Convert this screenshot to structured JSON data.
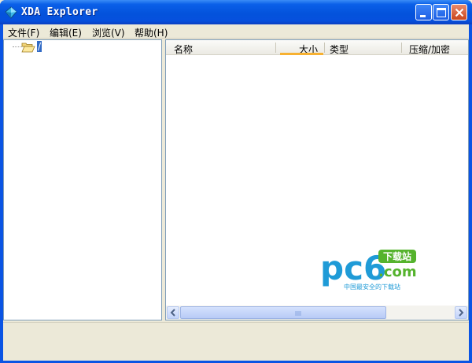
{
  "window": {
    "title": "XDA Explorer",
    "app_icon": "diamond-app-icon",
    "controls": [
      "minimize-icon",
      "maximize-icon",
      "close-icon"
    ]
  },
  "menu": {
    "items": [
      {
        "label": "文件(F)"
      },
      {
        "label": "编辑(E)"
      },
      {
        "label": "浏览(V)"
      },
      {
        "label": "帮助(H)"
      }
    ]
  },
  "tree": {
    "root": {
      "label": "/",
      "icon": "open-folder-icon",
      "selected": true
    }
  },
  "file_list": {
    "columns": [
      {
        "label": "名称"
      },
      {
        "label": "大小",
        "sorted": true
      },
      {
        "label": "类型"
      },
      {
        "label": "压缩/加密"
      }
    ],
    "rows": []
  },
  "watermark": {
    "logo": "pc6",
    "dotcom": ".com",
    "badge": "下载站",
    "tagline": "中国最安全的下载站"
  },
  "colors": {
    "titlebar": "#0453dc",
    "selection": "#316ac5",
    "sort_indicator": "#f7b131",
    "watermark_blue": "#1f9bd7",
    "watermark_green": "#55b32d"
  }
}
